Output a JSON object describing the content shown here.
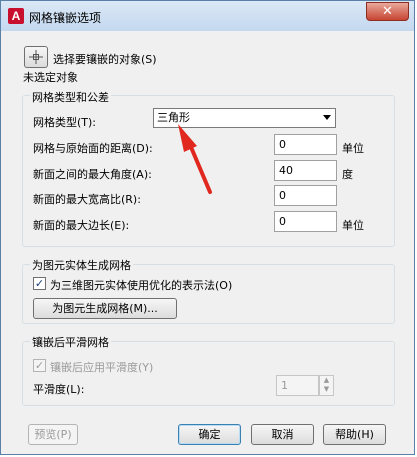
{
  "window": {
    "title": "网格镶嵌选项",
    "close_glyph": "✕"
  },
  "select_objects": {
    "button_label": "选择要镶嵌的对象(S)",
    "status": "未选定对象"
  },
  "mesh_group": {
    "title": "网格类型和公差",
    "mesh_type_label": "网格类型(T):",
    "mesh_type_value": "三角形",
    "distance_label": "网格与原始面的距离(D):",
    "distance_value": "0",
    "distance_unit": "单位",
    "angle_label": "新面之间的最大角度(A):",
    "angle_value": "40",
    "angle_unit": "度",
    "aspect_label": "新面的最大宽高比(R):",
    "aspect_value": "0",
    "edge_label": "新面的最大边长(E):",
    "edge_value": "0",
    "edge_unit": "单位"
  },
  "primitive_group": {
    "title": "为图元实体生成网格",
    "optimized_label": "为三维图元实体使用优化的表示法(O)",
    "optimized_checked": true,
    "generate_button": "为图元生成网格(M)..."
  },
  "smooth_group": {
    "title": "镶嵌后平滑网格",
    "apply_label": "镶嵌后应用平滑度(Y)",
    "apply_checked": true,
    "level_label": "平滑度(L):",
    "level_value": "1"
  },
  "footer": {
    "preview": "预览(P)",
    "ok": "确定",
    "cancel": "取消",
    "help": "帮助(H)"
  },
  "annotation": {
    "color": "#e0281e"
  }
}
